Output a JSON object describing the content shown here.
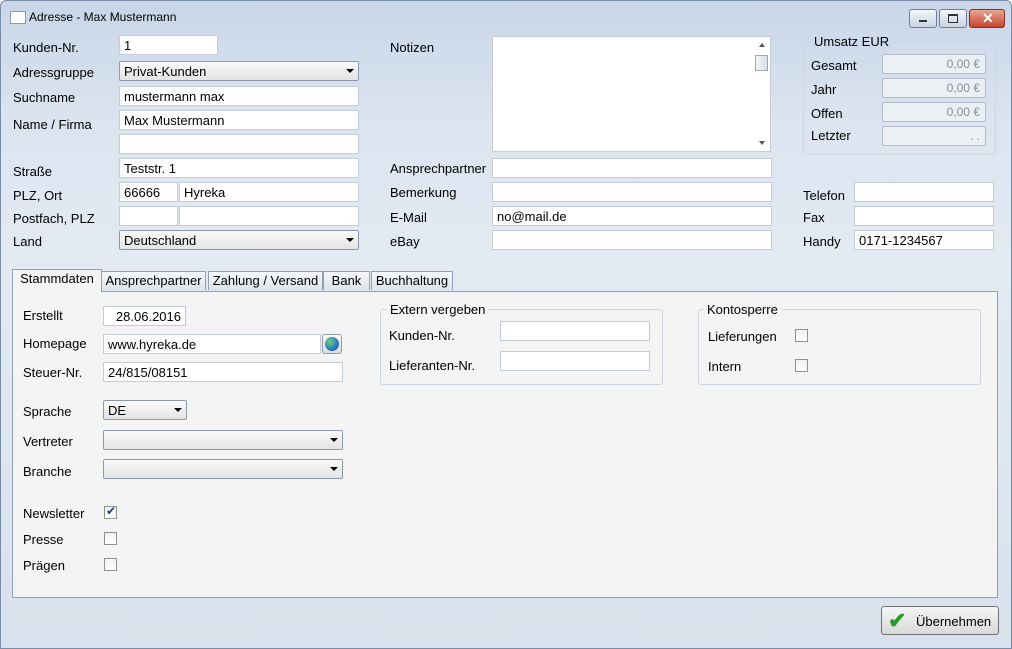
{
  "window": {
    "title": "Adresse - Max Mustermann",
    "close_glyph": "✕"
  },
  "customer": {
    "kunden_nr_label": "Kunden-Nr.",
    "kunden_nr": "1",
    "adressgruppe_label": "Adressgruppe",
    "adressgruppe": "Privat-Kunden",
    "suchname_label": "Suchname",
    "suchname": "mustermann max",
    "name_label": "Name / Firma",
    "name": "Max Mustermann",
    "name2": "",
    "strasse_label": "Straße",
    "strasse": "Teststr. 1",
    "plz_ort_label": "PLZ, Ort",
    "plz": "66666",
    "ort": "Hyreka",
    "postfach_label": "Postfach, PLZ",
    "postfach": "",
    "postfach_plz": "",
    "land_label": "Land",
    "land": "Deutschland"
  },
  "notes": {
    "label": "Notizen",
    "value": ""
  },
  "contact": {
    "ansprechpartner_label": "Ansprechpartner",
    "ansprechpartner": "",
    "bemerkung_label": "Bemerkung",
    "bemerkung": "",
    "email_label": "E-Mail",
    "email": "no@mail.de",
    "ebay_label": "eBay",
    "ebay": "",
    "telefon_label": "Telefon",
    "telefon": "",
    "fax_label": "Fax",
    "fax": "",
    "handy_label": "Handy",
    "handy": "0171-1234567"
  },
  "umsatz": {
    "title": "Umsatz EUR",
    "gesamt_label": "Gesamt",
    "gesamt": "0,00 €",
    "jahr_label": "Jahr",
    "jahr": "0,00 €",
    "offen_label": "Offen",
    "offen": "0,00 €",
    "letzter_label": "Letzter",
    "letzter": ". ."
  },
  "tabs": [
    {
      "label": "Stammdaten",
      "active": true
    },
    {
      "label": "Ansprechpartner",
      "active": false
    },
    {
      "label": "Zahlung / Versand",
      "active": false
    },
    {
      "label": "Bank",
      "active": false
    },
    {
      "label": "Buchhaltung",
      "active": false
    }
  ],
  "stammdaten": {
    "erstellt_label": "Erstellt",
    "erstellt": "28.06.2016",
    "homepage_label": "Homepage",
    "homepage": "www.hyreka.de",
    "steuer_label": "Steuer-Nr.",
    "steuer": "24/815/08151",
    "sprache_label": "Sprache",
    "sprache": "DE",
    "vertreter_label": "Vertreter",
    "vertreter": "",
    "branche_label": "Branche",
    "branche": "",
    "newsletter_label": "Newsletter",
    "newsletter": true,
    "presse_label": "Presse",
    "presse": false,
    "praegen_label": "Prägen",
    "praegen": false
  },
  "extern": {
    "title": "Extern vergeben",
    "kunden_nr_label": "Kunden-Nr.",
    "kunden_nr": "",
    "lieferanten_nr_label": "Lieferanten-Nr.",
    "lieferanten_nr": ""
  },
  "kontosperre": {
    "title": "Kontosperre",
    "lieferungen_label": "Lieferungen",
    "lieferungen": false,
    "intern_label": "Intern",
    "intern": false
  },
  "footer": {
    "ok_label": "Übernehmen",
    "check_glyph": "✔"
  }
}
